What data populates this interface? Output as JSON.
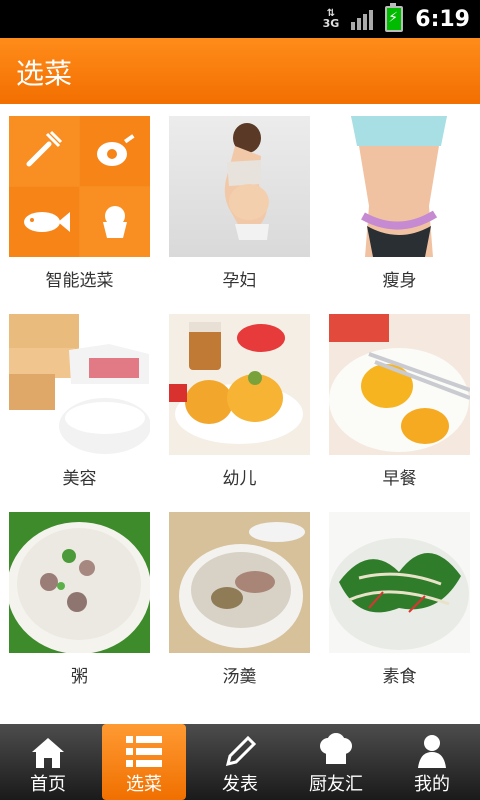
{
  "status": {
    "network": "3G",
    "time": "6:19"
  },
  "header": {
    "title": "选菜"
  },
  "categories": [
    {
      "label": "智能选菜",
      "image": "smart-select-icons"
    },
    {
      "label": "孕妇",
      "image": "pregnant-woman-photo"
    },
    {
      "label": "瘦身",
      "image": "waist-measure-photo"
    },
    {
      "label": "美容",
      "image": "beauty-food-photo"
    },
    {
      "label": "幼儿",
      "image": "kids-food-photo"
    },
    {
      "label": "早餐",
      "image": "fried-egg-photo"
    },
    {
      "label": "粥",
      "image": "porridge-photo"
    },
    {
      "label": "汤羹",
      "image": "soup-photo"
    },
    {
      "label": "素食",
      "image": "vegetable-salad-photo"
    }
  ],
  "tabs": [
    {
      "label": "首页",
      "icon": "home-icon"
    },
    {
      "label": "选菜",
      "icon": "list-icon",
      "active": true
    },
    {
      "label": "发表",
      "icon": "pencil-icon"
    },
    {
      "label": "厨友汇",
      "icon": "chef-hat-icon"
    },
    {
      "label": "我的",
      "icon": "user-icon"
    }
  ],
  "colors": {
    "accent": "#f57f0a",
    "tab_bar": "#2a2a2a"
  }
}
